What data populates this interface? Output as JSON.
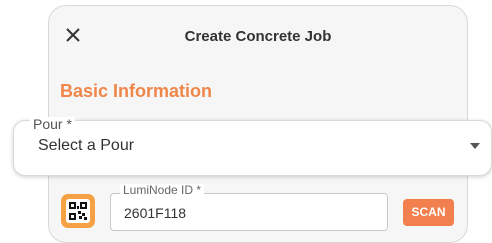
{
  "header": {
    "title": "Create Concrete Job",
    "close_icon": "close-icon"
  },
  "sections": {
    "basic_information": "Basic Information"
  },
  "pour": {
    "label": "Pour *",
    "selected": "Select a Pour",
    "dropdown_icon": "chevron-down-icon"
  },
  "lumi_node": {
    "label": "LumiNode ID *",
    "value": "2601F118",
    "icon": "luminode-device-icon",
    "scan_label": "SCAN"
  },
  "colors": {
    "accent": "#f0864a",
    "scan_button": "#f27f4e",
    "icon_badge": "#f5a144",
    "card_background": "#f6f6f6"
  }
}
